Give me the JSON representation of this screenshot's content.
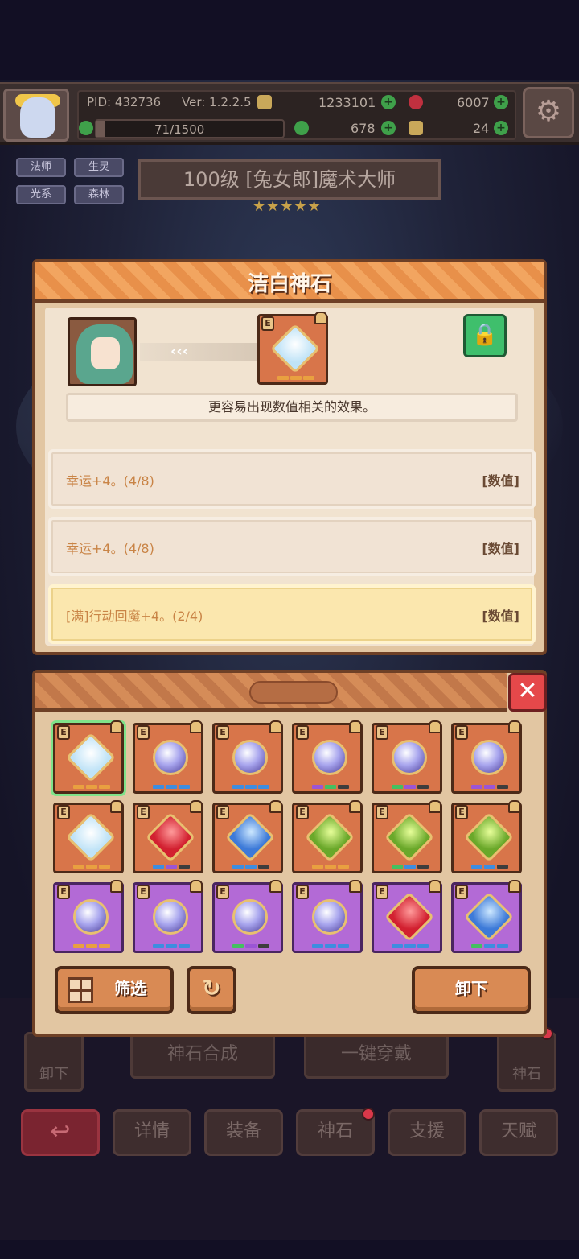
{
  "topbar": {
    "pid": "PID: 432736",
    "version": "Ver: 1.2.2.5",
    "gold": "1233101",
    "gems": "6007",
    "energy": "71/1500",
    "energy_fraction": 0.047,
    "clover": "678",
    "keys": "24"
  },
  "hero": {
    "tags": [
      "法师",
      "生灵",
      "光系",
      "森林"
    ],
    "title": "100级 [兔女郎]魔术大师",
    "stars": "★★★★★"
  },
  "detail": {
    "title": "洁白神石",
    "arrows": "‹‹‹",
    "lock_icon": "lock-icon",
    "description": "更容易出现数值相关的效果。",
    "attributes": [
      {
        "text": "幸运+4。(4/8)",
        "tag": "[数值]"
      },
      {
        "text": "幸运+4。(4/8)",
        "tag": "[数值]"
      },
      {
        "text": "[满]行动回魔+4。(2/4)",
        "tag": "[数值]"
      }
    ]
  },
  "inventory": {
    "close": "✕",
    "filter_label": "筛选",
    "refresh_icon": "↻",
    "unequip_label": "卸下",
    "cells": [
      {
        "frame": "orange",
        "gem": "white",
        "pips": [
          "#e9a040",
          "#e9a040",
          "#e9a040"
        ],
        "selected": true
      },
      {
        "frame": "orange",
        "gem": "orb",
        "pips": [
          "#3d8de0",
          "#3d8de0",
          "#3d8de0"
        ]
      },
      {
        "frame": "orange",
        "gem": "orb",
        "pips": [
          "#3d8de0",
          "#3d8de0",
          "#3d8de0"
        ]
      },
      {
        "frame": "orange",
        "gem": "orb",
        "pips": [
          "#9b55d6",
          "#44c060",
          "#3d3d3d"
        ]
      },
      {
        "frame": "orange",
        "gem": "orb",
        "pips": [
          "#44c060",
          "#9b55d6",
          "#3d3d3d"
        ]
      },
      {
        "frame": "orange",
        "gem": "orb",
        "pips": [
          "#9b55d6",
          "#9b55d6",
          "#3d3d3d"
        ]
      },
      {
        "frame": "orange",
        "gem": "white",
        "pips": [
          "#e9a040",
          "#e9a040",
          "#e9a040"
        ]
      },
      {
        "frame": "orange",
        "gem": "red",
        "pips": [
          "#3d8de0",
          "#9b55d6",
          "#3d3d3d"
        ]
      },
      {
        "frame": "orange",
        "gem": "blue",
        "pips": [
          "#3d8de0",
          "#3d8de0",
          "#3d3d3d"
        ]
      },
      {
        "frame": "orange",
        "gem": "green",
        "pips": [
          "#e9a040",
          "#e9a040",
          "#e9a040"
        ]
      },
      {
        "frame": "orange",
        "gem": "green",
        "pips": [
          "#44c060",
          "#3d8de0",
          "#3d3d3d"
        ]
      },
      {
        "frame": "orange",
        "gem": "green",
        "pips": [
          "#3d8de0",
          "#3d8de0",
          "#3d3d3d"
        ]
      },
      {
        "frame": "purple",
        "gem": "orb",
        "pips": [
          "#e9a040",
          "#e9a040",
          "#e9a040"
        ]
      },
      {
        "frame": "purple",
        "gem": "orb",
        "pips": [
          "#3d8de0",
          "#3d8de0",
          "#3d8de0"
        ]
      },
      {
        "frame": "purple",
        "gem": "orb",
        "pips": [
          "#44c060",
          "#9b55d6",
          "#3d3d3d"
        ]
      },
      {
        "frame": "purple",
        "gem": "orb",
        "pips": [
          "#3d8de0",
          "#3d8de0",
          "#3d8de0"
        ]
      },
      {
        "frame": "purple",
        "gem": "red",
        "pips": [
          "#3d8de0",
          "#3d8de0",
          "#3d8de0"
        ]
      },
      {
        "frame": "purple",
        "gem": "blue",
        "pips": [
          "#44c060",
          "#3d8de0",
          "#3d8de0"
        ]
      }
    ]
  },
  "underlay": {
    "unequip_left": "卸下",
    "synth": "神石合成",
    "equip_all": "一键穿戴",
    "gem_right": "神石"
  },
  "tabs": {
    "back_icon": "↩",
    "items": [
      "详情",
      "装备",
      "神石",
      "支援",
      "天赋"
    ]
  }
}
